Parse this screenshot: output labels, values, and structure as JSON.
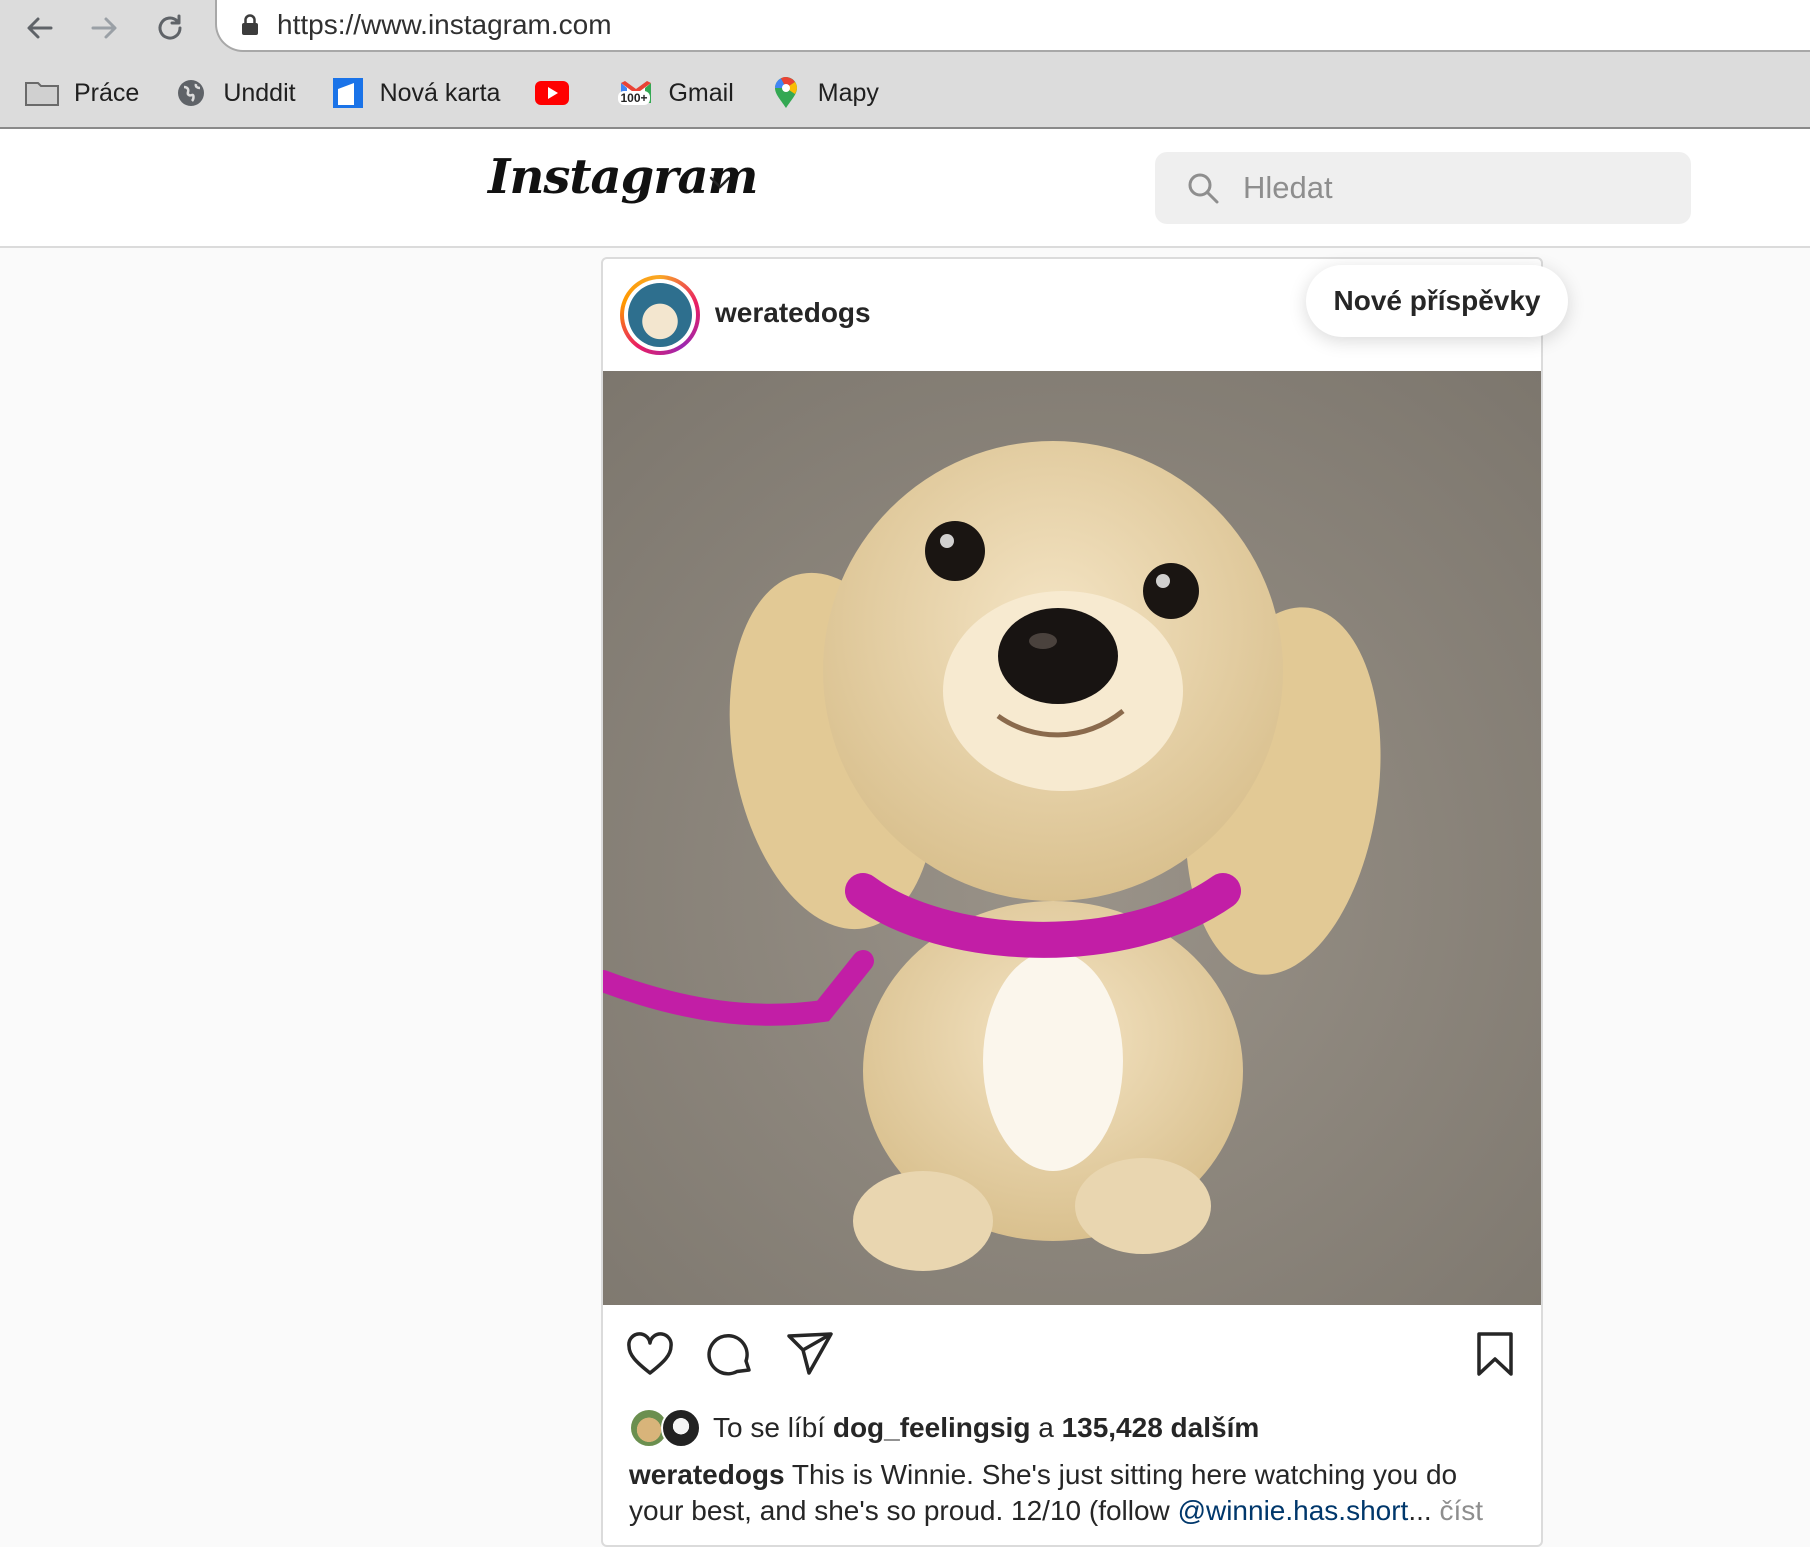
{
  "browser": {
    "url": "https://www.instagram.com",
    "bookmarks": [
      {
        "label": "Práce",
        "icon": "folder-icon"
      },
      {
        "label": "Unddit",
        "icon": "globe-icon"
      },
      {
        "label": "Nová karta",
        "icon": "new-tab-icon"
      },
      {
        "label": "",
        "icon": "youtube-icon"
      },
      {
        "label": "Gmail",
        "icon": "gmail-icon",
        "badge": "100+"
      },
      {
        "label": "Mapy",
        "icon": "maps-pin-icon"
      }
    ]
  },
  "header": {
    "logo_text": "Instagram",
    "search_placeholder": "Hledat"
  },
  "post": {
    "username": "weratedogs",
    "likes": {
      "prefix": "To se líbí",
      "liker": "dog_feelingsig",
      "joiner": "a",
      "count": "135,428 dalším"
    },
    "caption": {
      "author": "weratedogs",
      "text": "This is Winnie. She's just sitting here watching you do your best, and she's so proud. 12/10 (follow",
      "mention": "@winnie.has.short",
      "ellipsis": "...",
      "more": "číst"
    }
  },
  "new_posts_label": "Nové příspěvky",
  "colors": {
    "accent_ring": "#e91e63",
    "mention": "#00376b",
    "muted": "#8e8e8e"
  }
}
